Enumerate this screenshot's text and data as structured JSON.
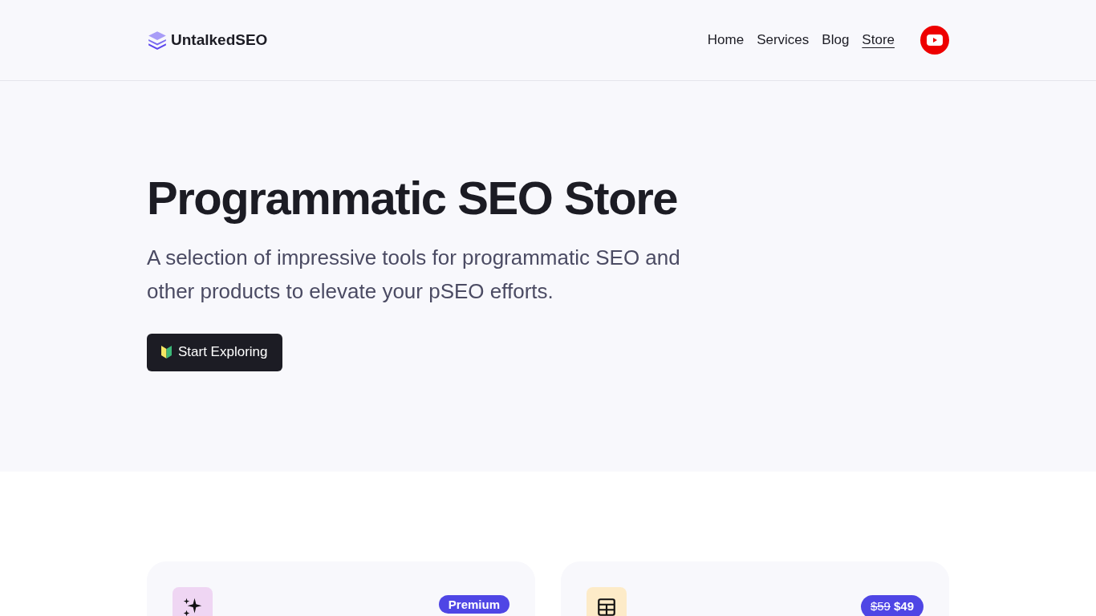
{
  "header": {
    "logo": "UntalkedSEO",
    "nav": [
      {
        "label": "Home",
        "selected": false
      },
      {
        "label": "Services",
        "selected": false
      },
      {
        "label": "Blog",
        "selected": false
      },
      {
        "label": "Store",
        "selected": true
      }
    ]
  },
  "hero": {
    "title": "Programmatic SEO Store",
    "subtitle": "A selection of impressive tools for programmatic SEO and other products to elevate your pSEO efforts.",
    "button": "Start Exploring"
  },
  "products": [
    {
      "kind": "sparkle",
      "badge": {
        "kind": "label",
        "text": "Premium"
      }
    },
    {
      "kind": "table",
      "badge": {
        "kind": "price",
        "old_price": "$59",
        "price": "$49"
      }
    }
  ]
}
